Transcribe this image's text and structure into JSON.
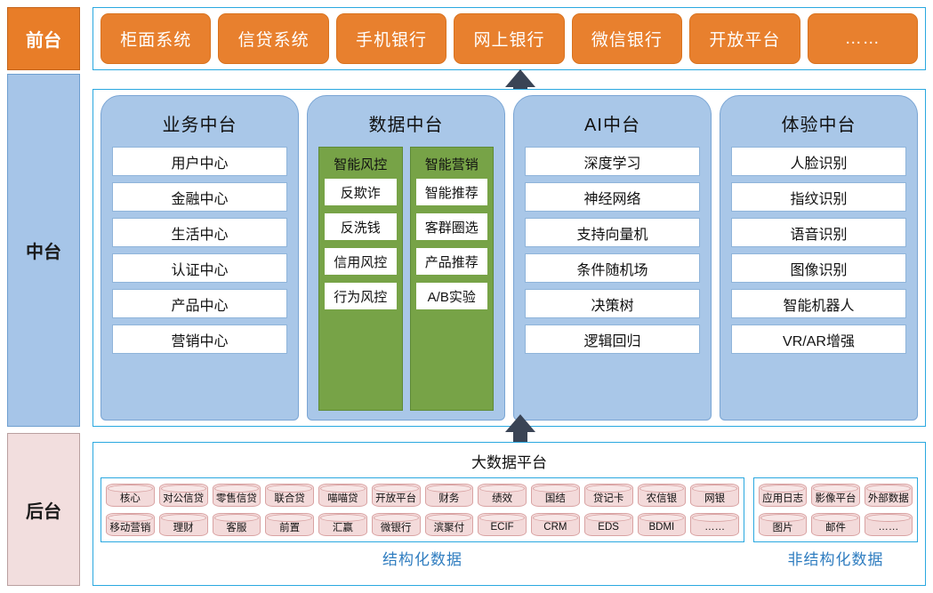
{
  "rail": {
    "front": "前台",
    "middle": "中台",
    "back": "后台"
  },
  "front_office": {
    "tiles": [
      "柜面系统",
      "信贷系统",
      "手机银行",
      "网上银行",
      "微信银行",
      "开放平台",
      "……"
    ]
  },
  "middle_platform": {
    "columns": [
      {
        "title": "业务中台",
        "items": [
          "用户中心",
          "金融中心",
          "生活中心",
          "认证中心",
          "产品中心",
          "营销中心"
        ]
      },
      {
        "title": "数据中台",
        "groups": [
          {
            "title": "智能风控",
            "items": [
              "反欺诈",
              "反洗钱",
              "信用风控",
              "行为风控"
            ]
          },
          {
            "title": "智能营销",
            "items": [
              "智能推荐",
              "客群圈选",
              "产品推荐",
              "A/B实验"
            ]
          }
        ]
      },
      {
        "title": "AI中台",
        "items": [
          "深度学习",
          "神经网络",
          "支持向量机",
          "条件随机场",
          "决策树",
          "逻辑回归"
        ]
      },
      {
        "title": "体验中台",
        "items": [
          "人脸识别",
          "指纹识别",
          "语音识别",
          "图像识别",
          "智能机器人",
          "VR/AR增强"
        ]
      }
    ]
  },
  "back_office": {
    "title": "大数据平台",
    "structured": {
      "label": "结构化数据",
      "row1": [
        "核心",
        "对公信贷",
        "零售信贷",
        "联合贷",
        "喵喵贷",
        "开放平台",
        "财务",
        "绩效",
        "国结",
        "贷记卡",
        "农信银",
        "网银"
      ],
      "row2": [
        "移动营销",
        "理财",
        "客服",
        "前置",
        "汇赢",
        "微银行",
        "滨聚付",
        "ECIF",
        "CRM",
        "EDS",
        "BDMI",
        "……"
      ]
    },
    "unstructured": {
      "label": "非结构化数据",
      "row1": [
        "应用日志",
        "影像平台",
        "外部数据"
      ],
      "row2": [
        "图片",
        "邮件",
        "……"
      ]
    }
  },
  "colors": {
    "front_orange": "#e8802e",
    "mid_blue": "#a9c7e8",
    "back_pink": "#f2dede",
    "green": "#77a347",
    "border_cyan": "#2aa8e0",
    "label_blue": "#2f7dc0",
    "arrow": "#3a4455"
  }
}
